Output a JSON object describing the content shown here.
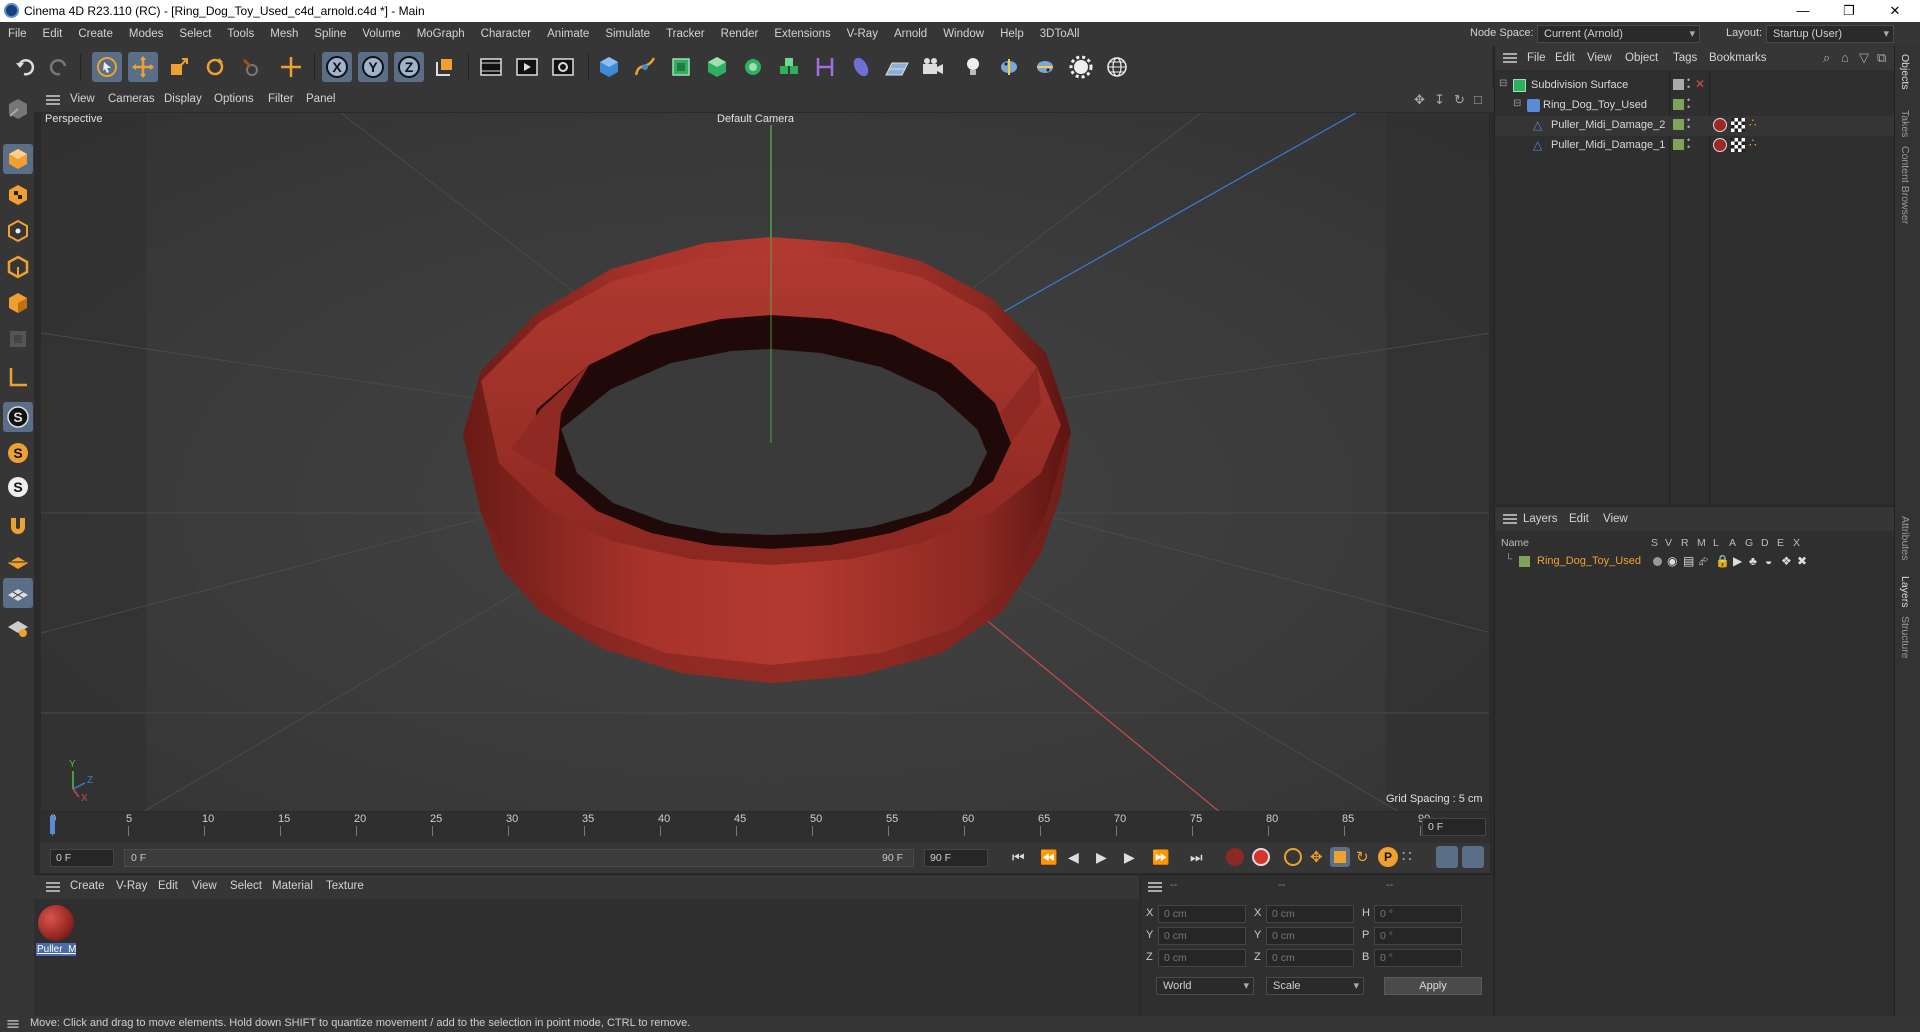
{
  "window": {
    "title": "Cinema 4D R23.110 (RC) - [Ring_Dog_Toy_Used_c4d_arnold.c4d *] - Main",
    "minimize": "—",
    "maximize": "❐",
    "close": "✕"
  },
  "menubar": {
    "items": [
      "File",
      "Edit",
      "Create",
      "Modes",
      "Select",
      "Tools",
      "Mesh",
      "Spline",
      "Volume",
      "MoGraph",
      "Character",
      "Animate",
      "Simulate",
      "Tracker",
      "Render",
      "Extensions",
      "V-Ray",
      "Arnold",
      "Window",
      "Help",
      "3DToAll"
    ],
    "node_space_label": "Node Space:",
    "node_space_value": "Current (Arnold)",
    "layout_label": "Layout:",
    "layout_value": "Startup (User)"
  },
  "viewport": {
    "menu": [
      "View",
      "Cameras",
      "Display",
      "Options",
      "Filter",
      "Panel"
    ],
    "view_name": "Perspective",
    "camera": "Default Camera",
    "grid_spacing": "Grid Spacing : 5 cm",
    "axis_labels": {
      "x": "X",
      "y": "Y",
      "z": "Z"
    },
    "colors": {
      "ring": "#a8332b",
      "background": "#3a3a3a",
      "x_axis": "#c84a4a",
      "y_axis": "#4ac04a",
      "z_axis": "#3a7ad8"
    }
  },
  "timeline": {
    "ticks": [
      "0",
      "5",
      "10",
      "15",
      "20",
      "25",
      "30",
      "35",
      "40",
      "45",
      "50",
      "55",
      "60",
      "65",
      "70",
      "75",
      "80",
      "85",
      "90"
    ],
    "current_frame": "0 F",
    "start_field": "0 F",
    "range_start": "0 F",
    "range_end": "90 F",
    "end_field": "90 F"
  },
  "materials": {
    "menu": [
      "Create",
      "V-Ray",
      "Edit",
      "View",
      "Select",
      "Material",
      "Texture"
    ],
    "items": [
      {
        "name": "Puller_M",
        "color": "#9b2a25"
      }
    ]
  },
  "coordinates": {
    "header": [
      "--",
      "--",
      "--"
    ],
    "rows": [
      {
        "a": "X",
        "av": "0 cm",
        "b": "X",
        "bv": "0 cm",
        "c": "H",
        "cv": "0 °"
      },
      {
        "a": "Y",
        "av": "0 cm",
        "b": "Y",
        "bv": "0 cm",
        "c": "P",
        "cv": "0 °"
      },
      {
        "a": "Z",
        "av": "0 cm",
        "b": "Z",
        "bv": "0 cm",
        "c": "B",
        "cv": "0 °"
      }
    ],
    "mode": "World",
    "scale": "Scale",
    "apply": "Apply"
  },
  "object_manager": {
    "menu": [
      "File",
      "Edit",
      "View",
      "Object",
      "Tags",
      "Bookmarks"
    ],
    "objects": [
      {
        "name": "Subdivision Surface",
        "level": 0
      },
      {
        "name": "Ring_Dog_Toy_Used",
        "level": 1
      },
      {
        "name": "Puller_Midi_Damage_2",
        "level": 2
      },
      {
        "name": "Puller_Midi_Damage_1",
        "level": 2
      }
    ]
  },
  "layers": {
    "menu": [
      "Layers",
      "Edit",
      "View"
    ],
    "columns": [
      "Name",
      "S",
      "V",
      "R",
      "M",
      "L",
      "A",
      "G",
      "D",
      "E",
      "X"
    ],
    "items": [
      {
        "name": "Ring_Dog_Toy_Used",
        "color": "#7fa35a"
      }
    ]
  },
  "side_tabs": [
    "Objects",
    "Takes",
    "Content Browser",
    "Attributes",
    "Layers",
    "Structure"
  ],
  "status": "Move: Click and drag to move elements. Hold down SHIFT to quantize movement / add to the selection in point mode, CTRL to remove."
}
